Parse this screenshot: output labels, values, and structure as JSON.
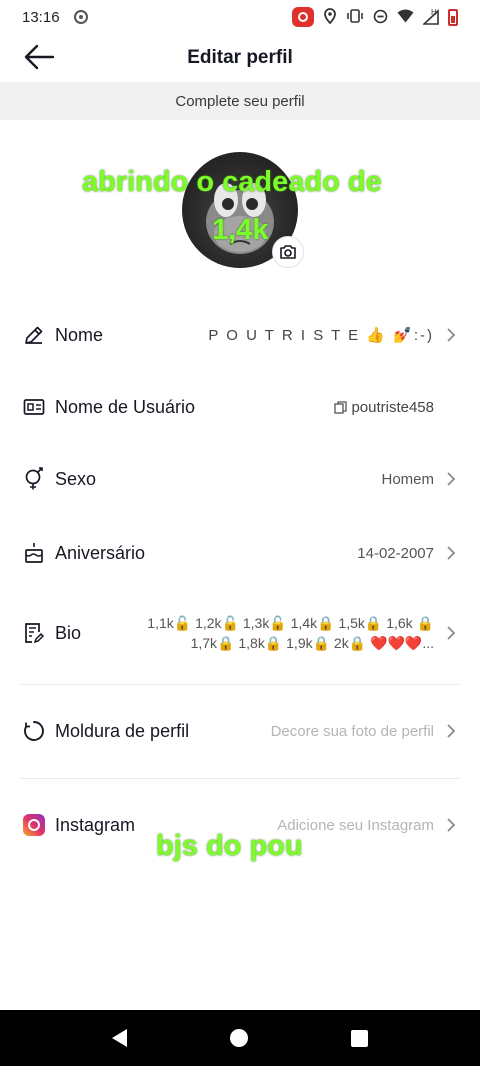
{
  "status_bar": {
    "time": "13:16",
    "icons": [
      "screen-record-icon",
      "location-icon",
      "vibrate-icon",
      "dnd-icon",
      "wifi-icon",
      "signal-icon",
      "battery-icon"
    ],
    "network": "H"
  },
  "header": {
    "title": "Editar perfil",
    "back_icon": "arrow-left-icon"
  },
  "banner": {
    "text": "Complete seu perfil"
  },
  "avatar": {
    "camera_icon": "camera-icon"
  },
  "overlay": {
    "line1": "abrindo o cadeado de",
    "line2": "1,4k",
    "footer": "bjs do pou"
  },
  "fields": {
    "name": {
      "label": "Nome",
      "value": "P O U  T R I S T E 👍 💅:-)",
      "icon": "pencil-icon"
    },
    "username": {
      "label": "Nome de Usuário",
      "value": "poutriste458",
      "icon": "id-card-icon",
      "copy_icon": "copy-icon"
    },
    "gender": {
      "label": "Sexo",
      "value": "Homem",
      "icon": "gender-icon"
    },
    "birthday": {
      "label": "Aniversário",
      "value": "14-02-2007",
      "icon": "cake-icon"
    },
    "bio": {
      "label": "Bio",
      "value": "1,1k🔓  1,2k🔓 1,3k🔓 1,4k🔒  1,5k🔒  1,6k 🔒 1,7k🔒 1,8k🔒 1,9k🔒 2k🔒 ❤️❤️❤️...",
      "icon": "edit-note-icon"
    },
    "frame": {
      "label": "Moldura de perfil",
      "value": "Decore sua foto de perfil",
      "icon": "frame-circle-icon"
    },
    "instagram": {
      "label": "Instagram",
      "value": "Adicione seu Instagram",
      "icon": "instagram-icon"
    }
  },
  "nav_bar": {
    "icons": [
      "nav-back-icon",
      "nav-home-icon",
      "nav-recent-icon"
    ]
  },
  "colors": {
    "overlay_text": "#7cfc2a",
    "banner_bg": "#f1f1f2",
    "placeholder": "#b5b5b8"
  }
}
